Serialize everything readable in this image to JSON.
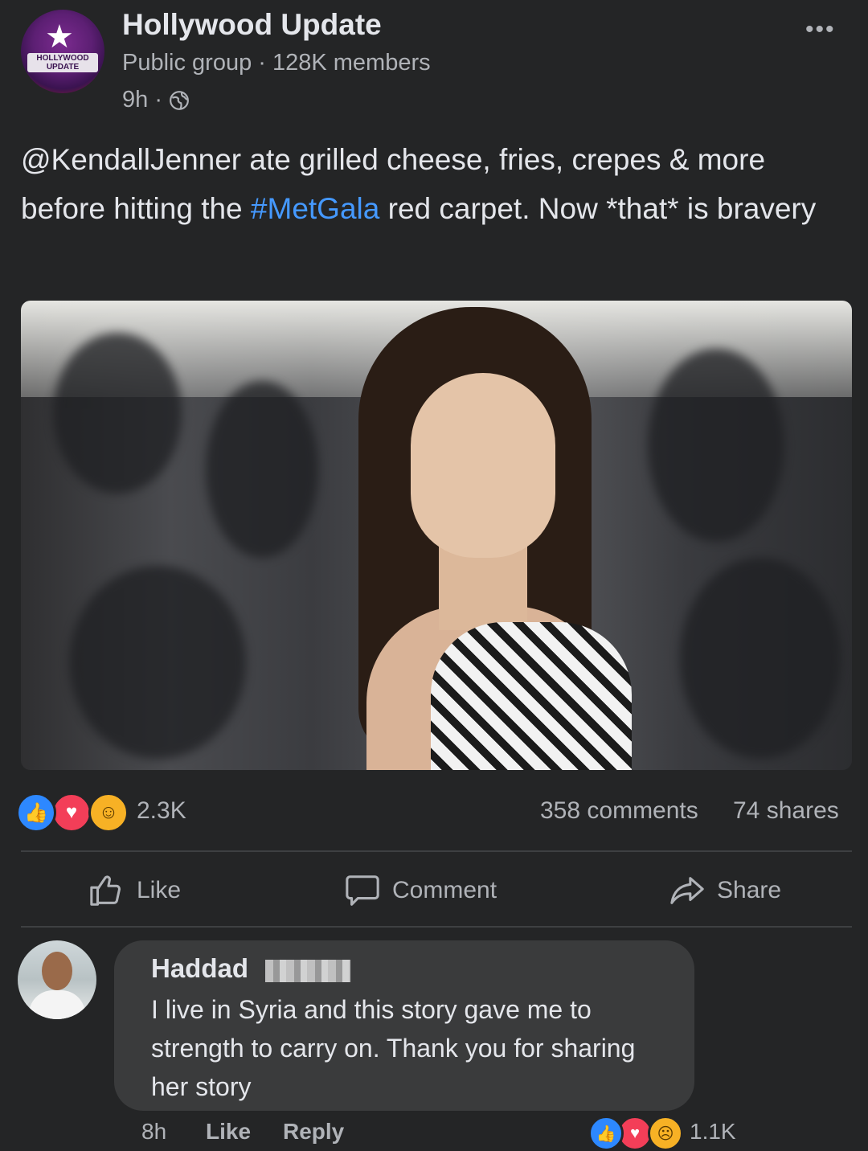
{
  "group": {
    "name": "Hollywood Update",
    "meta": "Public group · 128K members",
    "time": "9h ·",
    "logo_text": "HOLLYWOOD UPDATE",
    "logo_icon": "star-icon"
  },
  "post": {
    "text_before": "@KendallJenner ate grilled cheese, fries, crepes & more before hitting the ",
    "hashtag": "#MetGala",
    "text_after": " red carpet. Now *that* is bravery",
    "more_icon": "more-options-icon",
    "hashtag_color": "#4599ff"
  },
  "stats": {
    "reactions": "2.3K",
    "comments": "358 comments",
    "shares": "74 shares",
    "reaction_icons": [
      "like-icon",
      "love-icon",
      "haha-icon"
    ]
  },
  "actions": {
    "like": "Like",
    "comment": "Comment",
    "share": "Share"
  },
  "comment": {
    "author": "Haddad",
    "text": "I live in Syria and this story gave me to strength to carry on. Thank you for sharing her story",
    "time": "8h",
    "like": "Like",
    "reply": "Reply",
    "reactions": "1.1K",
    "reaction_icons": [
      "like-icon",
      "love-icon",
      "sad-icon"
    ]
  },
  "colors": {
    "background": "#242526",
    "bubble": "#3a3b3c",
    "like_blue": "#2d88ff",
    "love_red": "#f33e58",
    "emoji_yellow": "#f7b125"
  }
}
